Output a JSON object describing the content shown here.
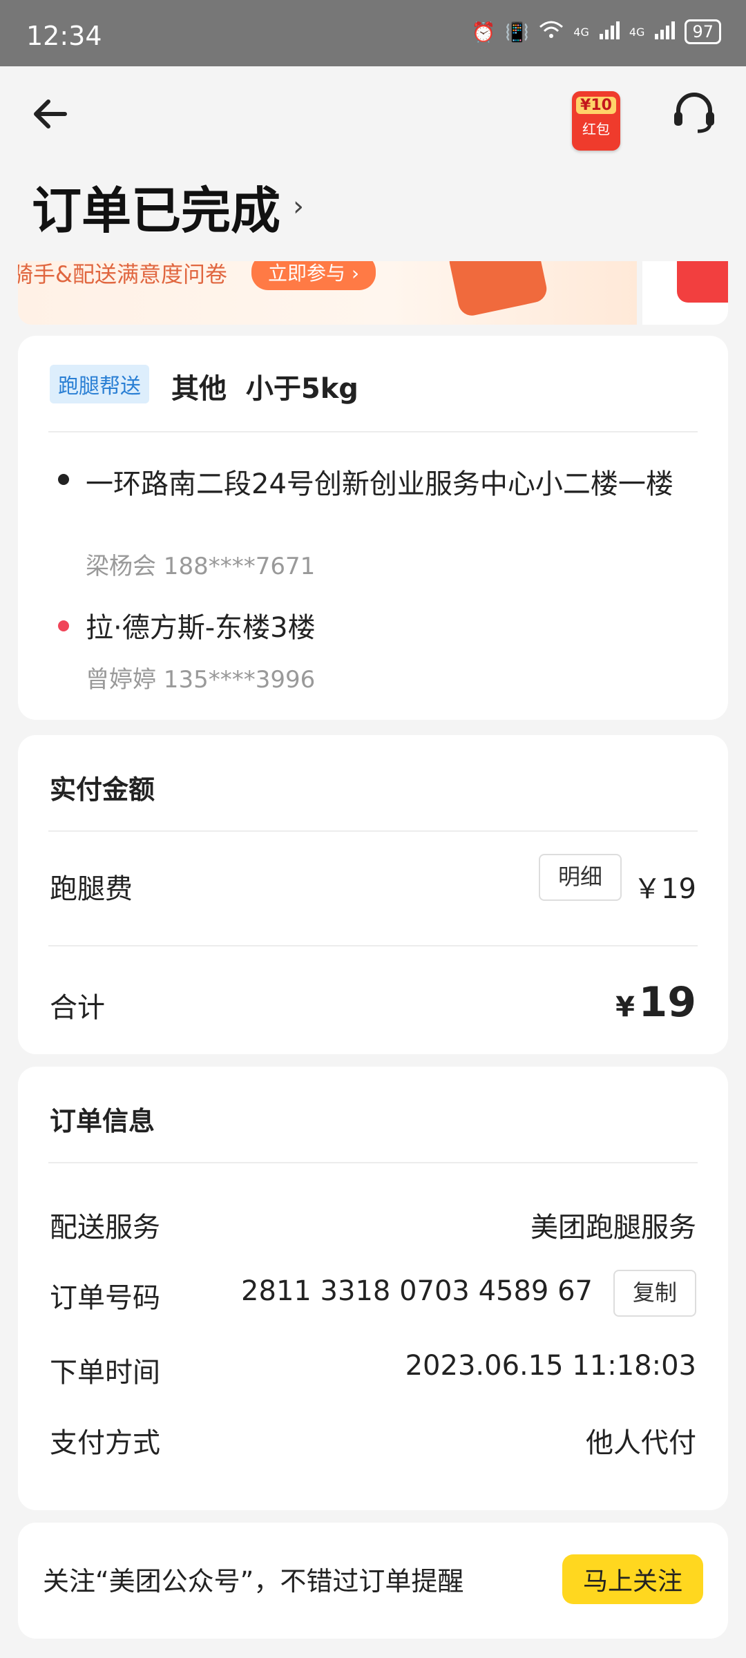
{
  "status_bar": {
    "time": "12:34",
    "battery": "97",
    "net1": "4G",
    "net2": "4G"
  },
  "header": {
    "red_packet_amount": "¥10",
    "red_packet_label": "红包",
    "title": "订单已完成",
    "title_chevron": "›"
  },
  "banner": {
    "text": "骑手&配送满意度问卷",
    "button": "立即参与 ›"
  },
  "package": {
    "tag": "跑腿帮送",
    "category": "其他",
    "weight": "小于5kg",
    "pickup_address": "一环路南二段24号创新创业服务中心小二楼一楼",
    "pickup_contact": "梁杨会 188****7671",
    "dropoff_address": "拉·德方斯-东楼3楼",
    "dropoff_contact": "曾婷婷 135****3996"
  },
  "payment": {
    "title": "实付金额",
    "fee_label": "跑腿费",
    "detail_button": "明细",
    "fee_value": "￥19",
    "total_label": "合计",
    "total_currency": "¥",
    "total_value": "19"
  },
  "order_info": {
    "title": "订单信息",
    "rows": [
      {
        "label": "配送服务",
        "value": "美团跑腿服务"
      },
      {
        "label": "订单号码",
        "value": "2811 3318 0703 4589 67"
      },
      {
        "label": "下单时间",
        "value": "2023.06.15 11:18:03"
      },
      {
        "label": "支付方式",
        "value": "他人代付"
      }
    ],
    "copy_button": "复制"
  },
  "follow": {
    "text": "关注“美团公众号”，不错过订单提醒",
    "button": "马上关注"
  },
  "colors": {
    "tag_bg": "#ddeefc",
    "tag_text": "#2a7fd4",
    "pickup_dot": "#222222",
    "dropoff_dot": "#f04458",
    "follow_button": "#ffd71f"
  }
}
